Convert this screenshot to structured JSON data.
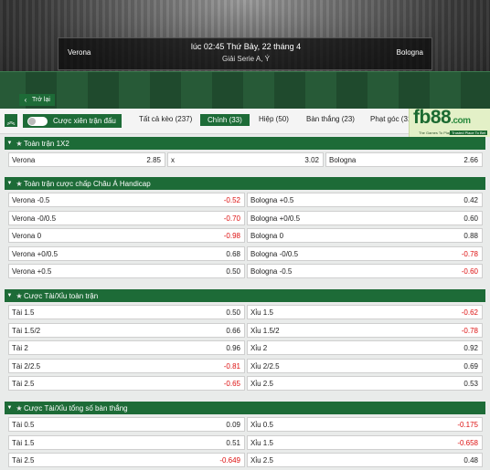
{
  "match": {
    "home": "Verona",
    "away": "Bologna",
    "time": "lúc 02:45 Thứ Bảy, 22 tháng 4",
    "league": "Giải Serie A, Ý"
  },
  "back_label": "Trở lại",
  "combo_label": "Cược xiên trận đấu",
  "tabs": [
    {
      "label": "Tất cả kèo (237)"
    },
    {
      "label": "Chính (33)"
    },
    {
      "label": "Hiệp (50)"
    },
    {
      "label": "Bàn thắng (23)"
    },
    {
      "label": "Phạt góc (31"
    }
  ],
  "logo": {
    "text": "fb88",
    "suffix": ".com",
    "tag": "The Games To Play",
    "tag2": "Trusted Place To Bet"
  },
  "sections": [
    {
      "title": "Toàn trận 1X2",
      "rows": [
        [
          {
            "label": "Verona",
            "odd": "2.85"
          },
          {
            "label": "x",
            "odd": "3.02"
          },
          {
            "label": "Bologna",
            "odd": "2.66"
          }
        ]
      ]
    },
    {
      "title": "Toàn trận cược chấp Châu Á Handicap",
      "rows": [
        [
          {
            "label": "Verona -0.5",
            "odd": "-0.52"
          },
          {
            "label": "Bologna +0.5",
            "odd": "0.42"
          }
        ],
        [
          {
            "label": "Verona -0/0.5",
            "odd": "-0.70"
          },
          {
            "label": "Bologna +0/0.5",
            "odd": "0.60"
          }
        ],
        [
          {
            "label": "Verona 0",
            "odd": "-0.98"
          },
          {
            "label": "Bologna 0",
            "odd": "0.88"
          }
        ],
        [
          {
            "label": "Verona +0/0.5",
            "odd": "0.68"
          },
          {
            "label": "Bologna -0/0.5",
            "odd": "-0.78"
          }
        ],
        [
          {
            "label": "Verona +0.5",
            "odd": "0.50"
          },
          {
            "label": "Bologna -0.5",
            "odd": "-0.60"
          }
        ]
      ]
    },
    {
      "title": "Cược Tài/Xỉu toàn trận",
      "rows": [
        [
          {
            "label": "Tài 1.5",
            "odd": "0.50"
          },
          {
            "label": "Xỉu 1.5",
            "odd": "-0.62"
          }
        ],
        [
          {
            "label": "Tài 1.5/2",
            "odd": "0.66"
          },
          {
            "label": "Xỉu 1.5/2",
            "odd": "-0.78"
          }
        ],
        [
          {
            "label": "Tài 2",
            "odd": "0.96"
          },
          {
            "label": "Xỉu 2",
            "odd": "0.92"
          }
        ],
        [
          {
            "label": "Tài 2/2.5",
            "odd": "-0.81"
          },
          {
            "label": "Xỉu 2/2.5",
            "odd": "0.69"
          }
        ],
        [
          {
            "label": "Tài 2.5",
            "odd": "-0.65"
          },
          {
            "label": "Xỉu 2.5",
            "odd": "0.53"
          }
        ]
      ]
    },
    {
      "title": "Cược Tài/Xỉu tổng số bàn thắng",
      "rows": [
        [
          {
            "label": "Tài 0.5",
            "odd": "0.09"
          },
          {
            "label": "Xỉu 0.5",
            "odd": "-0.175"
          }
        ],
        [
          {
            "label": "Tài 1.5",
            "odd": "0.51"
          },
          {
            "label": "Xỉu 1.5",
            "odd": "-0.658"
          }
        ],
        [
          {
            "label": "Tài 2.5",
            "odd": "-0.649"
          },
          {
            "label": "Xỉu 2.5",
            "odd": "0.48"
          }
        ]
      ]
    }
  ]
}
